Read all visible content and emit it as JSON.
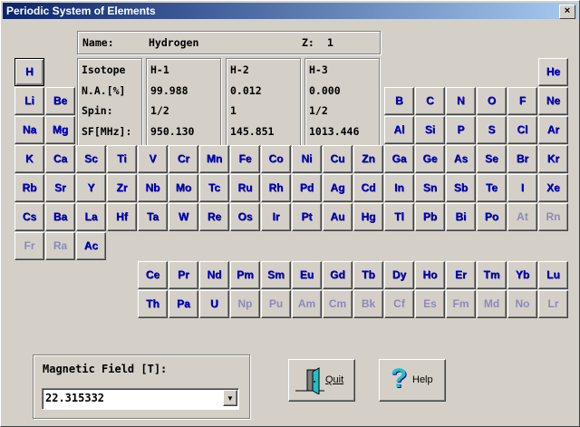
{
  "window": {
    "title": "Periodic System of Elements",
    "close_label": "×"
  },
  "info": {
    "name_label": "Name:",
    "name_value": "Hydrogen",
    "z_label": "Z:",
    "z_value": "1",
    "row_labels": [
      "Isotope",
      "N.A.[%]",
      "Spin:",
      "SF[MHz]:"
    ],
    "isotopes": [
      {
        "name": "H-1",
        "abundance": "99.988",
        "spin": "1/2",
        "sf": "950.130"
      },
      {
        "name": "H-2",
        "abundance": "0.012",
        "spin": "1",
        "sf": "145.851"
      },
      {
        "name": "H-3",
        "abundance": "0.000",
        "spin": "1/2",
        "sf": "1013.446"
      }
    ]
  },
  "selected": "H",
  "periods": [
    [
      "H",
      "He"
    ],
    [
      "Li",
      "Be",
      "B",
      "C",
      "N",
      "O",
      "F",
      "Ne"
    ],
    [
      "Na",
      "Mg",
      "Al",
      "Si",
      "P",
      "S",
      "Cl",
      "Ar"
    ],
    [
      "K",
      "Ca",
      "Sc",
      "Ti",
      "V",
      "Cr",
      "Mn",
      "Fe",
      "Co",
      "Ni",
      "Cu",
      "Zn",
      "Ga",
      "Ge",
      "As",
      "Se",
      "Br",
      "Kr"
    ],
    [
      "Rb",
      "Sr",
      "Y",
      "Zr",
      "Nb",
      "Mo",
      "Tc",
      "Ru",
      "Rh",
      "Pd",
      "Ag",
      "Cd",
      "In",
      "Sn",
      "Sb",
      "Te",
      "I",
      "Xe"
    ],
    [
      "Cs",
      "Ba",
      "La",
      "Hf",
      "Ta",
      "W",
      "Re",
      "Os",
      "Ir",
      "Pt",
      "Au",
      "Hg",
      "Tl",
      "Pb",
      "Bi",
      "Po",
      "At",
      "Rn"
    ],
    [
      "Fr",
      "Ra",
      "Ac"
    ]
  ],
  "lanthanides": [
    "Ce",
    "Pr",
    "Nd",
    "Pm",
    "Sm",
    "Eu",
    "Gd",
    "Tb",
    "Dy",
    "Ho",
    "Er",
    "Tm",
    "Yb",
    "Lu"
  ],
  "actinides": [
    "Th",
    "Pa",
    "U",
    "Np",
    "Pu",
    "Am",
    "Cm",
    "Bk",
    "Cf",
    "Es",
    "Fm",
    "Md",
    "No",
    "Lr"
  ],
  "disabled": [
    "At",
    "Rn",
    "Fr",
    "Ra",
    "Np",
    "Pu",
    "Am",
    "Cm",
    "Bk",
    "Cf",
    "Es",
    "Fm",
    "Md",
    "No",
    "Lr"
  ],
  "field": {
    "label": "Magnetic Field [T]:",
    "value": "22.315332"
  },
  "buttons": {
    "quit": "Quit",
    "help": "Help"
  }
}
